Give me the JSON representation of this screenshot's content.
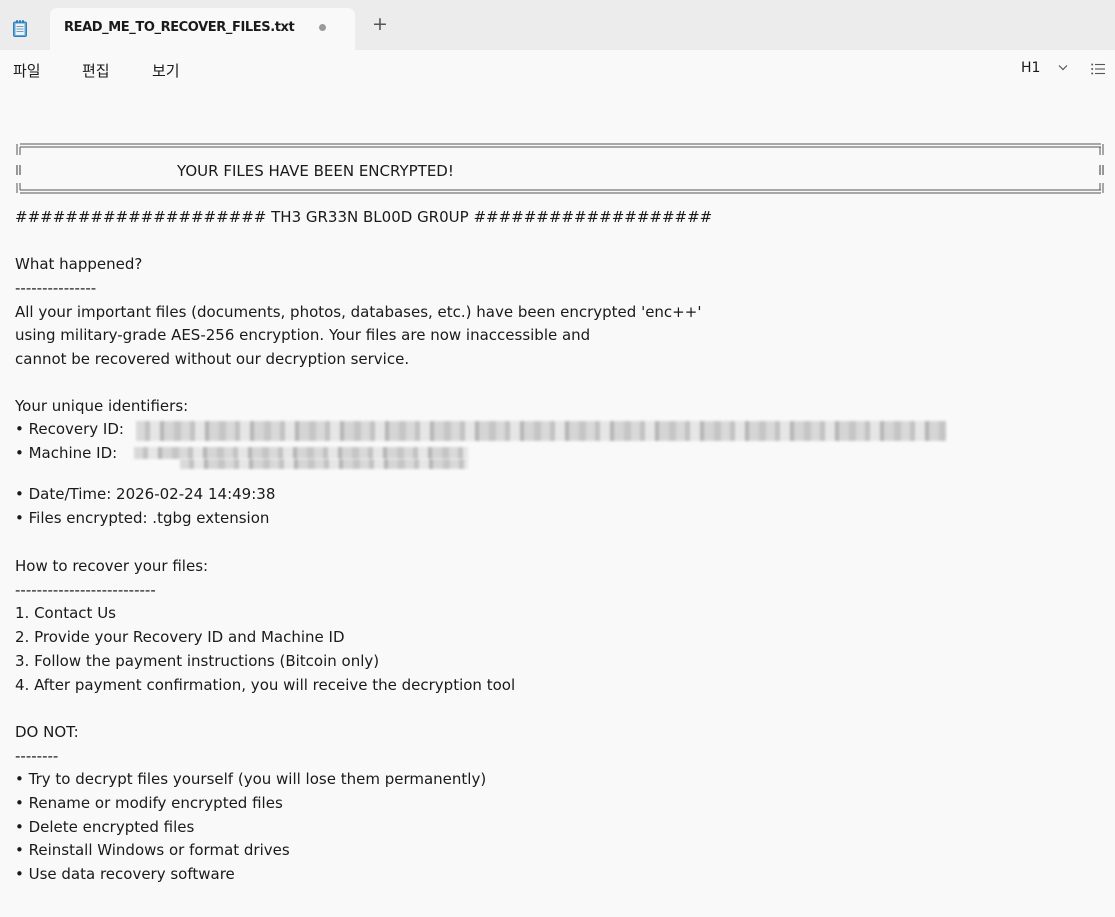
{
  "tab": {
    "title": "READ_ME_TO_RECOVER_FILES.txt",
    "new_tab_label": "+"
  },
  "menu": {
    "file": "파일",
    "edit": "편집",
    "view": "보기"
  },
  "toolbar": {
    "heading_value": "H1"
  },
  "icons": {
    "app": "notepad-icon",
    "unsaved": "unsaved-dot-icon",
    "chevron": "chevron-down-icon",
    "list": "bulleted-list-icon"
  },
  "document": {
    "banner": "YOUR FILES HAVE BEEN ENCRYPTED!",
    "group_line": "#################### TH3 GR33N BL00D GR0UP  ###################",
    "what_heading": "What happened?",
    "what_rule": "---------------",
    "what_p1": "All your important files (documents, photos, databases, etc.) have been encrypted 'enc++'",
    "what_p2": "using military-grade AES-256 encryption. Your files are now inaccessible and",
    "what_p3": "cannot be recovered without our decryption service.",
    "ids_heading": "Your unique identifiers:",
    "recovery_id_label": "• Recovery ID:",
    "machine_id_label": "• Machine ID:",
    "date_time": "• Date/Time: 2026-02-24 14:49:38",
    "files_encrypted": "• Files encrypted: .tgbg extension",
    "how_heading": "How to recover your files:",
    "how_rule": "--------------------------",
    "step1": "1. Contact Us",
    "step2": "2. Provide your Recovery ID and Machine ID",
    "step3": "3. Follow the payment instructions (Bitcoin only)",
    "step4": "4. After payment confirmation, you will receive the decryption tool",
    "donot_heading": "DO NOT:",
    "donot_rule": "--------",
    "donot1": "• Try to decrypt files yourself (you will lose them permanently)",
    "donot2": "• Rename or modify encrypted files",
    "donot3": "• Delete encrypted files",
    "donot4": "• Reinstall Windows or format drives",
    "donot5": "• Use data recovery software"
  }
}
